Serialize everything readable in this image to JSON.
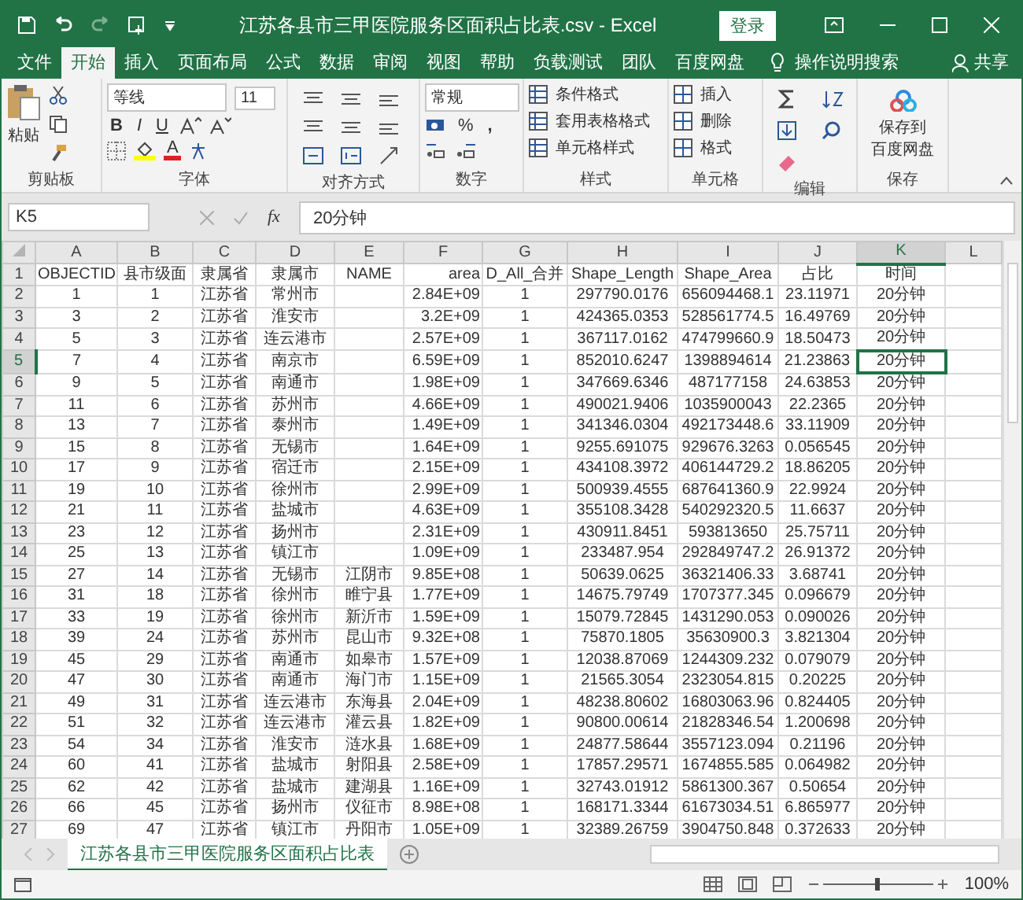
{
  "window": {
    "title": "江苏各县市三甲医院服务区面积占比表.csv  -  Excel",
    "login": "登录"
  },
  "menu_tabs": [
    {
      "label": "文件",
      "selected": false
    },
    {
      "label": "开始",
      "selected": true
    },
    {
      "label": "插入",
      "selected": false
    },
    {
      "label": "页面布局",
      "selected": false
    },
    {
      "label": "公式",
      "selected": false
    },
    {
      "label": "数据",
      "selected": false
    },
    {
      "label": "审阅",
      "selected": false
    },
    {
      "label": "视图",
      "selected": false
    },
    {
      "label": "帮助",
      "selected": false
    },
    {
      "label": "负载测试",
      "selected": false
    },
    {
      "label": "团队",
      "selected": false
    },
    {
      "label": "百度网盘",
      "selected": false
    }
  ],
  "tell_me": "操作说明搜索",
  "share": "共享",
  "ribbon": {
    "clipboard": {
      "paste": "粘贴",
      "label": "剪贴板"
    },
    "font": {
      "name": "等线",
      "size": "11",
      "bold": "B",
      "italic": "I",
      "underline": "U",
      "color_button": "A",
      "label": "字体"
    },
    "alignment": {
      "label": "对齐方式"
    },
    "number": {
      "format": "常规",
      "percent": "%",
      "comma": ",",
      "label": "数字"
    },
    "styles": {
      "items": [
        "条件格式",
        "套用表格格式",
        "单元格样式"
      ],
      "label": "样式"
    },
    "cells": {
      "items": [
        "插入",
        "删除",
        "格式"
      ],
      "label": "单元格"
    },
    "editing": {
      "label": "编辑"
    },
    "save": {
      "lines": [
        "保存到",
        "百度网盘"
      ],
      "label": "保存"
    }
  },
  "formula_bar": {
    "name_box": "K5",
    "fx": "fx",
    "value": "20分钟"
  },
  "sheet": {
    "columns": [
      {
        "letter": "A",
        "selected": false
      },
      {
        "letter": "B",
        "selected": false
      },
      {
        "letter": "C",
        "selected": false
      },
      {
        "letter": "D",
        "selected": false
      },
      {
        "letter": "E",
        "selected": false
      },
      {
        "letter": "F",
        "selected": false
      },
      {
        "letter": "G",
        "selected": false
      },
      {
        "letter": "H",
        "selected": false
      },
      {
        "letter": "I",
        "selected": false
      },
      {
        "letter": "J",
        "selected": false
      },
      {
        "letter": "K",
        "selected": true
      },
      {
        "letter": "L",
        "selected": false
      }
    ],
    "rows": [
      {
        "number": "1",
        "selected": false,
        "cells": [
          "OBJECTID",
          "县市级面",
          "隶属省",
          "隶属市",
          "NAME",
          "area",
          "D_All_合并",
          "Shape_Length",
          "Shape_Area",
          "占比",
          "时间"
        ]
      },
      {
        "number": "2",
        "selected": false,
        "cells": [
          "1",
          "1",
          "江苏省",
          "常州市",
          null,
          "2.84E+09",
          "1",
          "297790.0176",
          "656094468.1",
          "23.11971",
          "20分钟"
        ]
      },
      {
        "number": "3",
        "selected": false,
        "cells": [
          "3",
          "2",
          "江苏省",
          "淮安市",
          null,
          "3.2E+09",
          "1",
          "424365.0353",
          "528561774.5",
          "16.49769",
          "20分钟"
        ]
      },
      {
        "number": "4",
        "selected": false,
        "cells": [
          "5",
          "3",
          "江苏省",
          "连云港市",
          null,
          "2.57E+09",
          "1",
          "367117.0162",
          "474799660.9",
          "18.50473",
          "20分钟"
        ]
      },
      {
        "number": "5",
        "selected": true,
        "cells": [
          "7",
          "4",
          "江苏省",
          "南京市",
          null,
          "6.59E+09",
          "1",
          "852010.6247",
          "1398894614",
          "21.23863",
          "20分钟"
        ]
      },
      {
        "number": "6",
        "selected": false,
        "cells": [
          "9",
          "5",
          "江苏省",
          "南通市",
          null,
          "1.98E+09",
          "1",
          "347669.6346",
          "487177158",
          "24.63853",
          "20分钟"
        ]
      },
      {
        "number": "7",
        "selected": false,
        "cells": [
          "11",
          "6",
          "江苏省",
          "苏州市",
          null,
          "4.66E+09",
          "1",
          "490021.9406",
          "1035900043",
          "22.2365",
          "20分钟"
        ]
      },
      {
        "number": "8",
        "selected": false,
        "cells": [
          "13",
          "7",
          "江苏省",
          "泰州市",
          null,
          "1.49E+09",
          "1",
          "341346.0304",
          "492173448.6",
          "33.11909",
          "20分钟"
        ]
      },
      {
        "number": "9",
        "selected": false,
        "cells": [
          "15",
          "8",
          "江苏省",
          "无锡市",
          null,
          "1.64E+09",
          "1",
          "9255.691075",
          "929676.3263",
          "0.056545",
          "20分钟"
        ]
      },
      {
        "number": "10",
        "selected": false,
        "cells": [
          "17",
          "9",
          "江苏省",
          "宿迁市",
          null,
          "2.15E+09",
          "1",
          "434108.3972",
          "406144729.2",
          "18.86205",
          "20分钟"
        ]
      },
      {
        "number": "11",
        "selected": false,
        "cells": [
          "19",
          "10",
          "江苏省",
          "徐州市",
          null,
          "2.99E+09",
          "1",
          "500939.4555",
          "687641360.9",
          "22.9924",
          "20分钟"
        ]
      },
      {
        "number": "12",
        "selected": false,
        "cells": [
          "21",
          "11",
          "江苏省",
          "盐城市",
          null,
          "4.63E+09",
          "1",
          "355108.3428",
          "540292320.5",
          "11.6637",
          "20分钟"
        ]
      },
      {
        "number": "13",
        "selected": false,
        "cells": [
          "23",
          "12",
          "江苏省",
          "扬州市",
          null,
          "2.31E+09",
          "1",
          "430911.8451",
          "593813650",
          "25.75711",
          "20分钟"
        ]
      },
      {
        "number": "14",
        "selected": false,
        "cells": [
          "25",
          "13",
          "江苏省",
          "镇江市",
          null,
          "1.09E+09",
          "1",
          "233487.954",
          "292849747.2",
          "26.91372",
          "20分钟"
        ]
      },
      {
        "number": "15",
        "selected": false,
        "cells": [
          "27",
          "14",
          "江苏省",
          "无锡市",
          "江阴市",
          "9.85E+08",
          "1",
          "50639.0625",
          "36321406.33",
          "3.68741",
          "20分钟"
        ]
      },
      {
        "number": "16",
        "selected": false,
        "cells": [
          "31",
          "18",
          "江苏省",
          "徐州市",
          "睢宁县",
          "1.77E+09",
          "1",
          "14675.79749",
          "1707377.345",
          "0.096679",
          "20分钟"
        ]
      },
      {
        "number": "17",
        "selected": false,
        "cells": [
          "33",
          "19",
          "江苏省",
          "徐州市",
          "新沂市",
          "1.59E+09",
          "1",
          "15079.72845",
          "1431290.053",
          "0.090026",
          "20分钟"
        ]
      },
      {
        "number": "18",
        "selected": false,
        "cells": [
          "39",
          "24",
          "江苏省",
          "苏州市",
          "昆山市",
          "9.32E+08",
          "1",
          "75870.1805",
          "35630900.3",
          "3.821304",
          "20分钟"
        ]
      },
      {
        "number": "19",
        "selected": false,
        "cells": [
          "45",
          "29",
          "江苏省",
          "南通市",
          "如皋市",
          "1.57E+09",
          "1",
          "12038.87069",
          "1244309.232",
          "0.079079",
          "20分钟"
        ]
      },
      {
        "number": "20",
        "selected": false,
        "cells": [
          "47",
          "30",
          "江苏省",
          "南通市",
          "海门市",
          "1.15E+09",
          "1",
          "21565.3054",
          "2323054.815",
          "0.20225",
          "20分钟"
        ]
      },
      {
        "number": "21",
        "selected": false,
        "cells": [
          "49",
          "31",
          "江苏省",
          "连云港市",
          "东海县",
          "2.04E+09",
          "1",
          "48238.80602",
          "16803063.96",
          "0.824405",
          "20分钟"
        ]
      },
      {
        "number": "22",
        "selected": false,
        "cells": [
          "51",
          "32",
          "江苏省",
          "连云港市",
          "灌云县",
          "1.82E+09",
          "1",
          "90800.00614",
          "21828346.54",
          "1.200698",
          "20分钟"
        ]
      },
      {
        "number": "23",
        "selected": false,
        "cells": [
          "54",
          "34",
          "江苏省",
          "淮安市",
          "涟水县",
          "1.68E+09",
          "1",
          "24877.58644",
          "3557123.094",
          "0.21196",
          "20分钟"
        ]
      },
      {
        "number": "24",
        "selected": false,
        "cells": [
          "60",
          "41",
          "江苏省",
          "盐城市",
          "射阳县",
          "2.58E+09",
          "1",
          "17857.29571",
          "1674855.585",
          "0.064982",
          "20分钟"
        ]
      },
      {
        "number": "25",
        "selected": false,
        "cells": [
          "62",
          "42",
          "江苏省",
          "盐城市",
          "建湖县",
          "1.16E+09",
          "1",
          "32743.01912",
          "5861300.367",
          "0.50654",
          "20分钟"
        ]
      },
      {
        "number": "26",
        "selected": false,
        "cells": [
          "66",
          "45",
          "江苏省",
          "扬州市",
          "仪征市",
          "8.98E+08",
          "1",
          "168171.3344",
          "61673034.51",
          "6.865977",
          "20分钟"
        ]
      },
      {
        "number": "27",
        "selected": false,
        "cells": [
          "69",
          "47",
          "江苏省",
          "镇江市",
          "丹阳市",
          "1.05E+09",
          "1",
          "32389.26759",
          "3904750.848",
          "0.372633",
          "20分钟"
        ]
      }
    ]
  },
  "sheet_tabs": [
    {
      "label": "江苏各县市三甲医院服务区面积占比表",
      "selected": true
    }
  ],
  "status_bar": {
    "zoom": "100%"
  }
}
